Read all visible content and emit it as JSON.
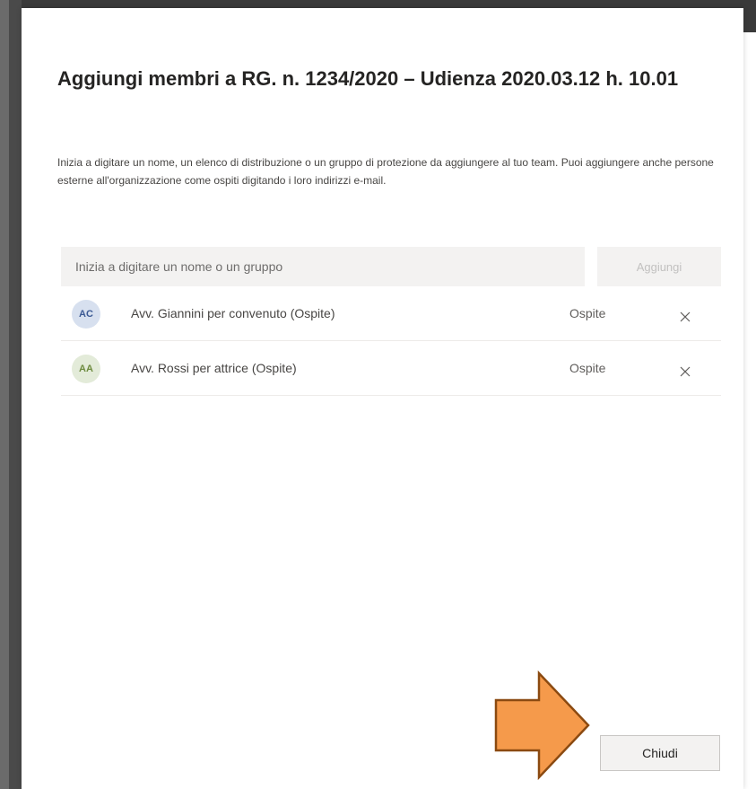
{
  "dialog": {
    "title": "Aggiungi membri a RG. n. 1234/2020 – Udienza 2020.03.12 h. 10.01",
    "instructions": "Inizia a digitare un nome, un elenco di distribuzione o un gruppo di protezione da aggiungere al tuo team. Puoi aggiungere anche persone esterne all'organizzazione come ospiti digitando i loro indirizzi e-mail.",
    "search": {
      "placeholder": "Inizia a digitare un nome o un gruppo",
      "value": ""
    },
    "add_button_label": "Aggiungi",
    "members": [
      {
        "initials": "AC",
        "name": "Avv. Giannini per convenuto (Ospite)",
        "role": "Ospite"
      },
      {
        "initials": "AA",
        "name": "Avv. Rossi per attrice (Ospite)",
        "role": "Ospite"
      }
    ],
    "close_button_label": "Chiudi"
  },
  "icons": {
    "remove": "close-icon",
    "annotation": "arrow-right-icon"
  },
  "colors": {
    "annotation_arrow_fill": "#f59a4b",
    "annotation_arrow_stroke": "#8b4a11",
    "avatar_blue_bg": "#d7e0ef",
    "avatar_green_bg": "#e3ebd9"
  }
}
